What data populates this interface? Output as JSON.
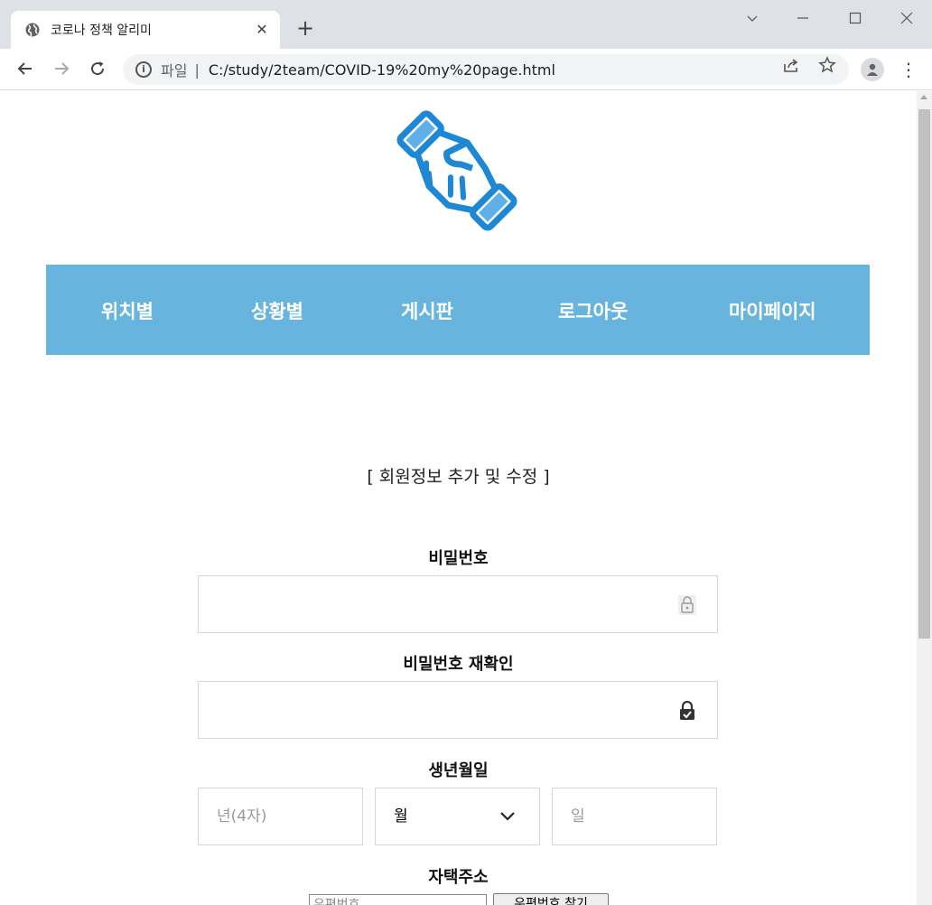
{
  "browser": {
    "tab_title": "코로나 정책 알리미",
    "new_tab": "+",
    "url_scheme": "파일",
    "url": "C:/study/2team/COVID-19%20my%20page.html"
  },
  "nav": {
    "items": [
      {
        "label": "위치별"
      },
      {
        "label": "상황별"
      },
      {
        "label": "게시판"
      },
      {
        "label": "로그아웃"
      },
      {
        "label": "마이페이지"
      }
    ]
  },
  "form": {
    "title": "[ 회원정보 추가 및 수정 ]",
    "password": {
      "label": "비밀번호",
      "value": ""
    },
    "password_confirm": {
      "label": "비밀번호 재확인",
      "value": ""
    },
    "birth": {
      "label": "생년월일",
      "year_placeholder": "년(4자)",
      "month_selected": "월",
      "day_placeholder": "일"
    },
    "address": {
      "label": "자택주소",
      "postal_placeholder": "우편번호",
      "postal_button": "우편번호 찾기"
    }
  },
  "colors": {
    "nav_bg": "#67b5de",
    "logo_blue": "#1e88d4",
    "logo_light": "#5fb0e6"
  }
}
